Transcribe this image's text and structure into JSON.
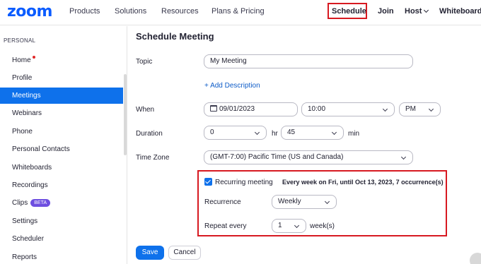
{
  "brand": {
    "logo": "zoom"
  },
  "nav": {
    "products": "Products",
    "solutions": "Solutions",
    "resources": "Resources",
    "plans": "Plans & Pricing",
    "schedule": "Schedule",
    "join": "Join",
    "host": "Host",
    "whiteboard": "Whiteboard"
  },
  "sidebar": {
    "heading": "PERSONAL",
    "items": [
      {
        "label": "Home"
      },
      {
        "label": "Profile"
      },
      {
        "label": "Meetings"
      },
      {
        "label": "Webinars"
      },
      {
        "label": "Phone"
      },
      {
        "label": "Personal Contacts"
      },
      {
        "label": "Whiteboards"
      },
      {
        "label": "Recordings"
      },
      {
        "label": "Clips",
        "badge": "BETA"
      },
      {
        "label": "Settings"
      },
      {
        "label": "Scheduler"
      },
      {
        "label": "Reports"
      }
    ]
  },
  "form": {
    "title": "Schedule Meeting",
    "topic_label": "Topic",
    "topic_value": "My Meeting",
    "add_description": "+ Add Description",
    "when_label": "When",
    "date_value": "09/01/2023",
    "time_value": "10:00",
    "ampm_value": "PM",
    "duration_label": "Duration",
    "duration_hr_value": "0",
    "hr_unit": "hr",
    "duration_min_value": "45",
    "min_unit": "min",
    "timezone_label": "Time Zone",
    "timezone_value": "(GMT-7:00) Pacific Time (US and Canada)",
    "recurring_label": "Recurring meeting",
    "recurring_checked": true,
    "recurring_summary": "Every week on Fri, until Oct 13, 2023, 7 occurrence(s)",
    "recurrence_label": "Recurrence",
    "recurrence_value": "Weekly",
    "repeat_label": "Repeat every",
    "repeat_value": "1",
    "repeat_unit": "week(s)",
    "save": "Save",
    "cancel": "Cancel"
  },
  "colors": {
    "brand_blue": "#0b5cff",
    "active_blue": "#0e71eb",
    "highlight_red": "#d71921",
    "beta_purple": "#6e4fe0"
  }
}
